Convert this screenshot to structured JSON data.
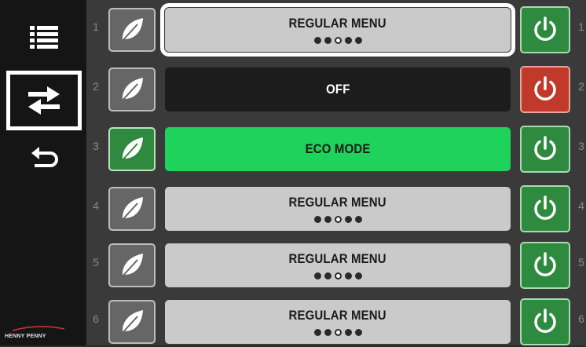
{
  "sidebar": {
    "buttons": [
      {
        "name": "menu-list-icon"
      },
      {
        "name": "swap-arrows-icon",
        "selected": true
      },
      {
        "name": "back-arrow-icon"
      }
    ],
    "brand": "HENNY PENNY"
  },
  "rows": [
    {
      "number": "1",
      "mode": "regular",
      "label": "REGULAR MENU",
      "dots_active_index": 2,
      "dots_total": 5,
      "power": "on",
      "leaf_active": false,
      "selected": true
    },
    {
      "number": "2",
      "mode": "off",
      "label": "OFF",
      "power": "off",
      "leaf_active": false,
      "selected": false
    },
    {
      "number": "3",
      "mode": "eco",
      "label": "ECO MODE",
      "power": "on",
      "leaf_active": true,
      "selected": false
    },
    {
      "number": "4",
      "mode": "regular",
      "label": "REGULAR MENU",
      "dots_active_index": 2,
      "dots_total": 5,
      "power": "on",
      "leaf_active": false,
      "selected": false
    },
    {
      "number": "5",
      "mode": "regular",
      "label": "REGULAR MENU",
      "dots_active_index": 2,
      "dots_total": 5,
      "power": "on",
      "leaf_active": false,
      "selected": false
    },
    {
      "number": "6",
      "mode": "regular",
      "label": "REGULAR MENU",
      "dots_active_index": 2,
      "dots_total": 5,
      "power": "on",
      "leaf_active": false,
      "selected": false
    }
  ],
  "colors": {
    "power_on": "#2e8a3f",
    "power_off": "#c0392b",
    "eco": "#1fd25c",
    "regular": "#cacaca",
    "off": "#1c1c1c"
  }
}
